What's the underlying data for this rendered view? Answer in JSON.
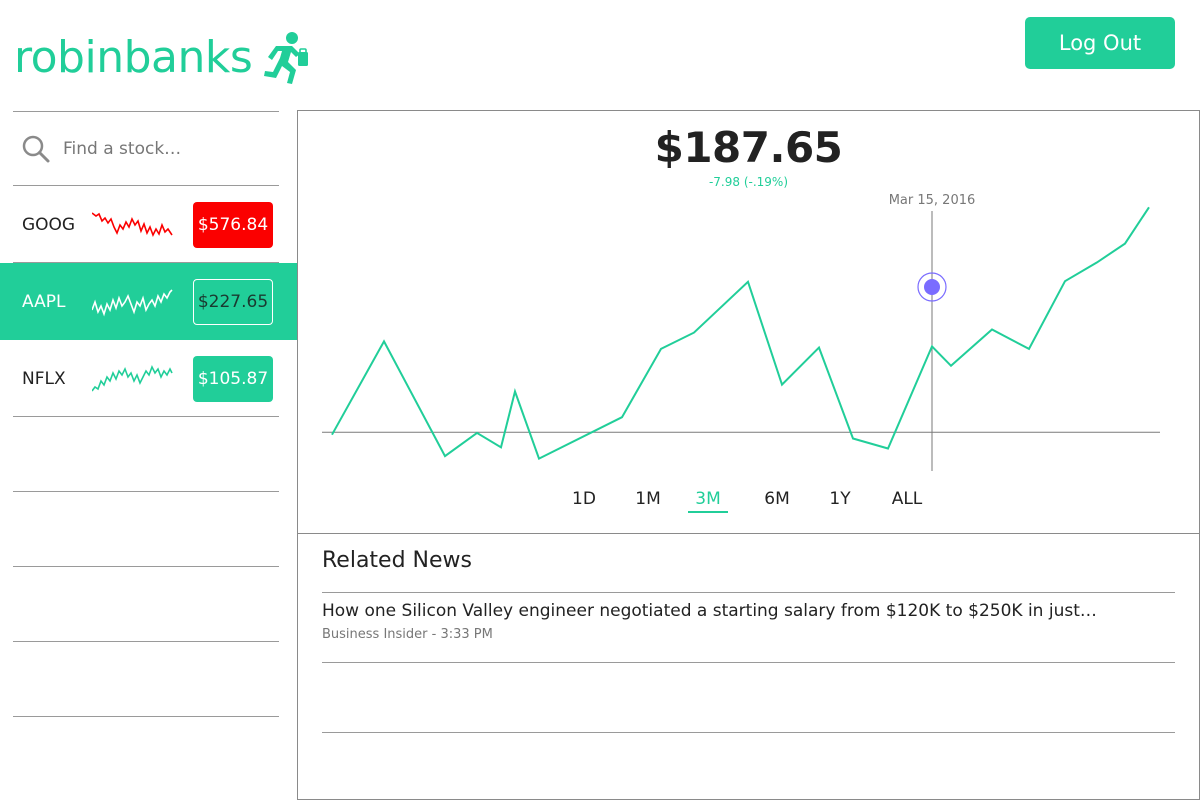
{
  "app": {
    "name": "robinbanks",
    "logout_label": "Log Out"
  },
  "colors": {
    "accent": "#21ce99",
    "negative": "#fb0000",
    "marker": "#7a6cff"
  },
  "sidebar": {
    "search_placeholder": "Find a stock…",
    "stocks": [
      {
        "ticker": "GOOG",
        "price": "$576.84",
        "trend": "down",
        "style": "red"
      },
      {
        "ticker": "AAPL",
        "price": "$227.65",
        "trend": "up",
        "style": "outline",
        "selected": true
      },
      {
        "ticker": "NFLX",
        "price": "$105.87",
        "trend": "up",
        "style": "green"
      }
    ]
  },
  "main": {
    "price": "$187.65",
    "change": "-7.98 (-.19%)",
    "hover_date": "Mar 15, 2016",
    "ranges": [
      "1D",
      "1M",
      "3M",
      "6M",
      "1Y",
      "ALL"
    ],
    "selected_range": "3M"
  },
  "chart_data": {
    "type": "line",
    "title": "",
    "xlabel": "",
    "ylabel": "",
    "series": [
      {
        "values": [
          177.7,
          192.6,
          174.3,
          178.0,
          175.7,
          184.6,
          173.9,
          180.5,
          191.4,
          194.0,
          202.1,
          185.7,
          191.6,
          177.1,
          175.5,
          191.8,
          188.7,
          194.5,
          191.4,
          202.2,
          205.2,
          208.2,
          214.0
        ]
      }
    ],
    "highlight": {
      "label": "Mar 15, 2016",
      "index": 15
    },
    "baseline": 178.1
  },
  "news": {
    "title": "Related News",
    "items": [
      {
        "headline": "How one Silicon Valley engineer negotiated a starting salary from $120K to $250K in just…",
        "meta": "Business Insider - 3:33 PM"
      }
    ]
  }
}
